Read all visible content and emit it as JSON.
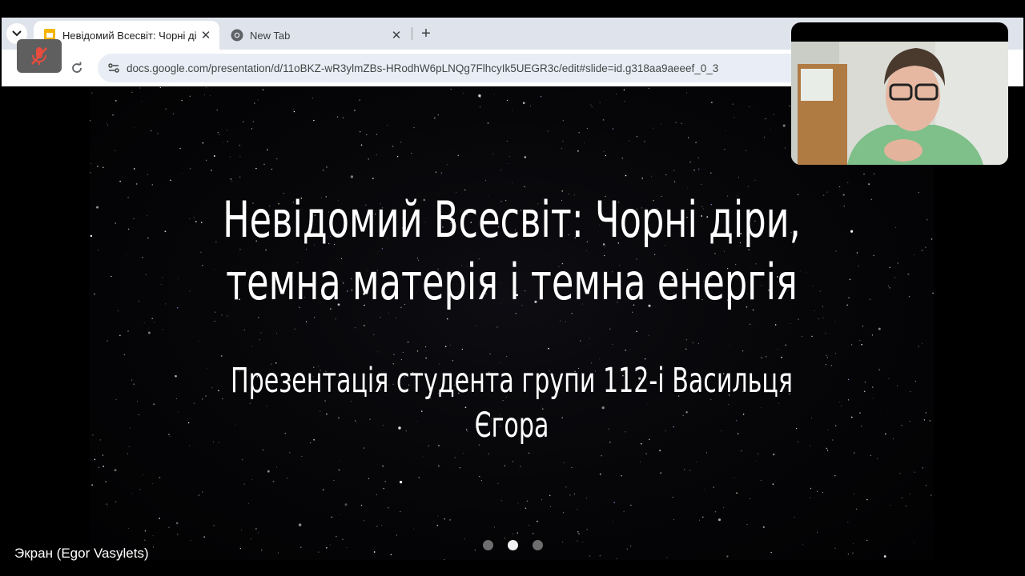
{
  "browser": {
    "tabs": [
      {
        "title": "Невідомий Всесвіт: Чорні діри",
        "icon": "google-slides-icon",
        "active": true,
        "close": "✕"
      },
      {
        "title": "New Tab",
        "icon": "chrome-icon",
        "active": false,
        "close": "✕"
      }
    ],
    "new_tab": "+",
    "url": "docs.google.com/presentation/d/11oBKZ-wR3ylmZBs-HRodhW6pLNQg7FlhcyIk5UEGR3c/edit#slide=id.g318aa9aeeef_0_3"
  },
  "slide": {
    "title_line1": "Невідомий Всесвіт: Чорні діри,",
    "title_line2": "темна матерія і темна енергія",
    "subtitle": "Презентація студента групи 112-і Васильця Єгора"
  },
  "call": {
    "screen_label": "Экран (Egor Vasylets)",
    "mic_state": "muted",
    "page_dots": 3,
    "active_dot": 2
  },
  "colors": {
    "slide_bg": "#050507",
    "tab_strip": "#dfe3eb",
    "omnibox": "#e9eef6",
    "mute_badge_icon": "#e74c3c"
  }
}
